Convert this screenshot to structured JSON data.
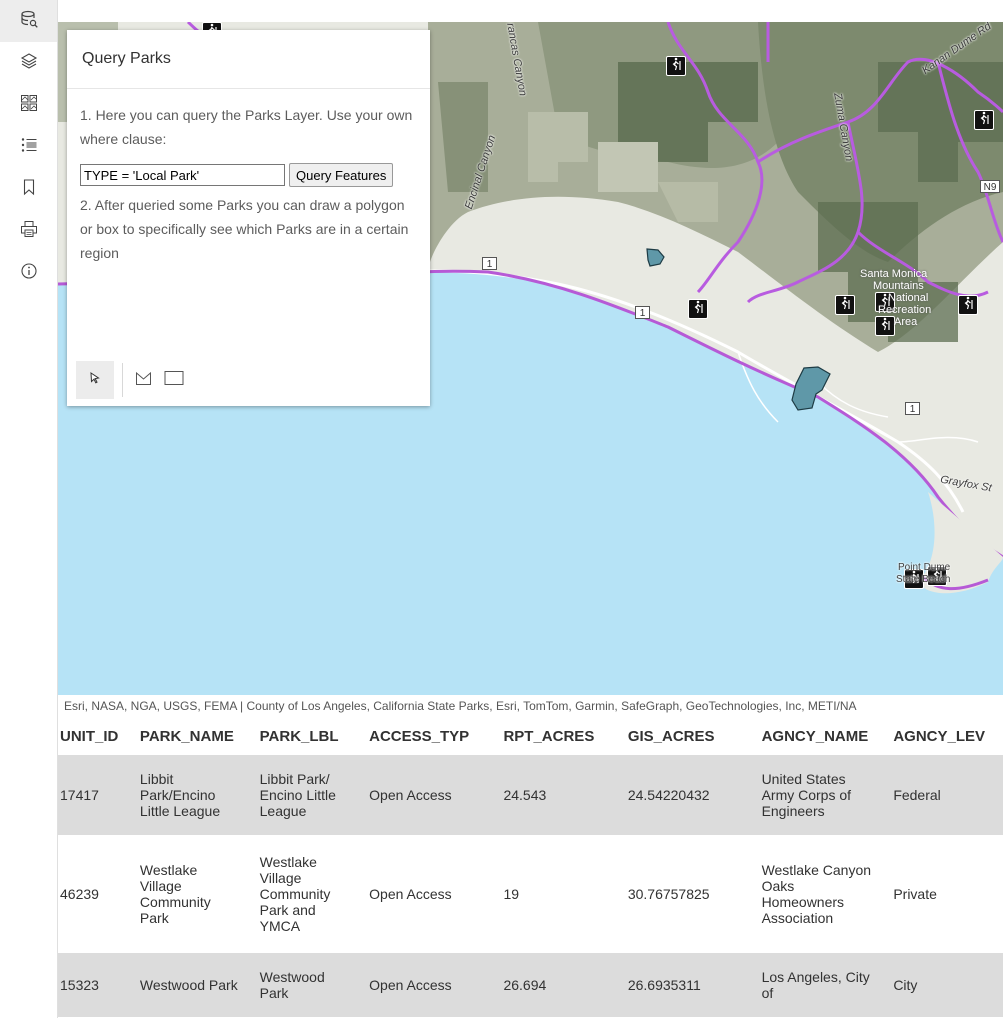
{
  "toolbar": {
    "items": [
      {
        "name": "query-icon",
        "active": true
      },
      {
        "name": "layers-icon",
        "active": false
      },
      {
        "name": "basemap-gallery-icon",
        "active": false
      },
      {
        "name": "legend-icon",
        "active": false
      },
      {
        "name": "bookmark-icon",
        "active": false
      },
      {
        "name": "print-icon",
        "active": false
      },
      {
        "name": "info-icon",
        "active": false
      }
    ]
  },
  "panel": {
    "title": "Query Parks",
    "step1": "1. Here you can query the Parks Layer. Use your own where clause:",
    "where_value": "TYPE = 'Local Park'",
    "query_button": "Query Features",
    "step2": "2. After queried some Parks you can draw a polygon or box to specifically see which Parks are in a certain region",
    "draw_tools": [
      "select-cursor-icon",
      "polygon-icon",
      "rectangle-icon"
    ]
  },
  "map": {
    "labels": {
      "francisquito_canyon": "rancas Canyon",
      "zuma_canyon": "Zuma Canyon",
      "encinal_canyon": "Encinal Canyon",
      "santa_monica": "Santa Monica",
      "mountains": "Mountains",
      "national": "National",
      "recreation": "Recreation",
      "area": "Area",
      "grayfox": "Grayfox St",
      "point_dume": "Point Dume",
      "state_beach": "State Beach",
      "kanan_dume": "Kanan Dume Rd",
      "road_1": "1",
      "road_n9": "N9"
    },
    "colors": {
      "water": "#b6e3f6",
      "land": "#e8e9e2",
      "terrain": "#9ea68e",
      "park_fill": "#5e6e52",
      "trail": "#b85ce0",
      "coast": "#b65ad6",
      "query_result": "#5f98a8"
    }
  },
  "attribution": "Esri, NASA, NGA, USGS, FEMA | County of Los Angeles, California State Parks, Esri, TomTom, Garmin, SafeGraph, GeoTechnologies, Inc, METI/NA",
  "table": {
    "columns": [
      "UNIT_ID",
      "PARK_NAME",
      "PARK_LBL",
      "ACCESS_TYP",
      "RPT_ACRES",
      "GIS_ACRES",
      "AGNCY_NAME",
      "AGNCY_LEV"
    ],
    "rows": [
      [
        "17417",
        "Libbit Park/Encino Little League",
        "Libbit Park/ Encino Little League",
        "Open Access",
        "24.543",
        "24.54220432",
        "United States Army Corps of Engineers",
        "Federal"
      ],
      [
        "46239",
        "Westlake Village Community Park",
        "Westlake Village Community Park and YMCA",
        "Open Access",
        "19",
        "30.76757825",
        "Westlake Canyon Oaks Homeowners Association",
        "Private"
      ],
      [
        "15323",
        "Westwood Park",
        "Westwood Park",
        "Open Access",
        "26.694",
        "26.6935311",
        "Los Angeles, City of",
        "City"
      ]
    ]
  }
}
